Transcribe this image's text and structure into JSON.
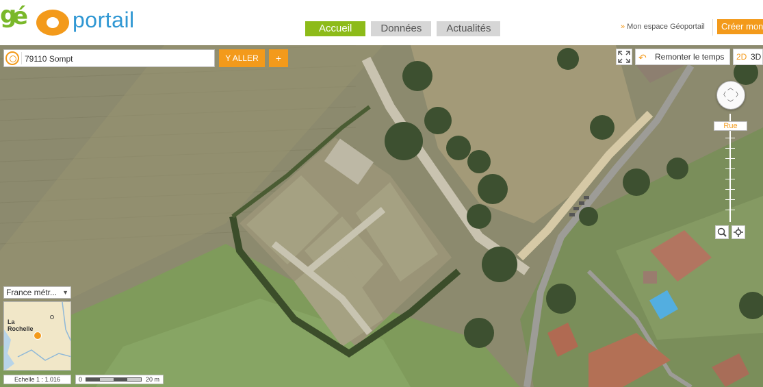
{
  "header": {
    "logo_text": "gEOportail",
    "nav": [
      {
        "label": "Accueil",
        "active": true
      },
      {
        "label": "Données",
        "active": false
      },
      {
        "label": "Actualités",
        "active": false
      }
    ],
    "espace_link": "Mon espace Géoportail",
    "create_button": "Créer mon"
  },
  "search": {
    "value": "79110 Sompt",
    "go_label": "Y ALLER",
    "plus_label": "+"
  },
  "map_controls": {
    "time_label": "Remonter le temps",
    "view_2d": "2D",
    "view_3d": "3D",
    "zoom_level_label": "Rue",
    "icons": [
      "fullscreen-icon",
      "undo-arrow-icon",
      "pan-arrows-icon",
      "zoom-box-icon",
      "locate-icon"
    ]
  },
  "overview": {
    "territory": "France métr...",
    "place_label": "La\nRochelle"
  },
  "scale": {
    "ratio": "Echelle 1 :  1.016",
    "zero": "0",
    "distance": "20 m"
  },
  "colors": {
    "accent_orange": "#f39a1b",
    "nav_active_green": "#8dbb19",
    "logo_blue": "#2f97d3"
  }
}
